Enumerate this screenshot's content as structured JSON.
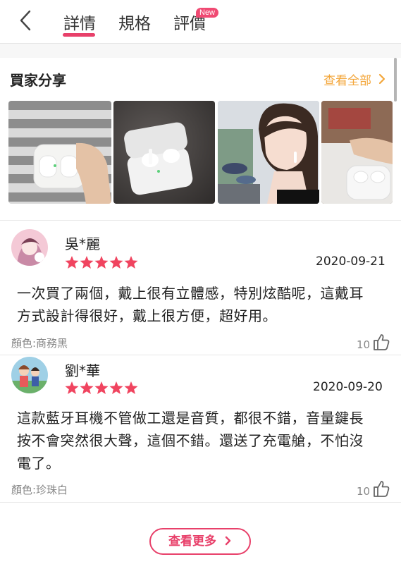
{
  "nav": {
    "tabs": [
      {
        "label": "詳情"
      },
      {
        "label": "規格"
      },
      {
        "label": "評價"
      }
    ],
    "new_badge": "New",
    "active_tab": "詳情",
    "accent_color": "#e8406a"
  },
  "buyer_share": {
    "title": "買家分享",
    "view_all": "查看全部"
  },
  "reviews": [
    {
      "name": "吳*麗",
      "rating": 5,
      "date": "2020-09-21",
      "text_line1": "一次買了兩個，戴上很有立體感，特別炫酷呢，這戴耳",
      "text_line2": "方式設計得很好，戴上很方便，超好用。",
      "variant": "顏色:商務黑",
      "likes": "10"
    },
    {
      "name": "劉*華",
      "rating": 5,
      "date": "2020-09-20",
      "text_line1": "這款藍牙耳機不管做工還是音質，都很不錯，音量鍵長",
      "text_line2": "按不會突然很大聲，這個不錯。還送了充電艙，不怕沒",
      "text_line3": "電了。",
      "variant": "顏色:珍珠白",
      "likes": "10"
    }
  ],
  "more_button": "查看更多",
  "star_color": "#f0445f",
  "link_color": "#f3a63a"
}
